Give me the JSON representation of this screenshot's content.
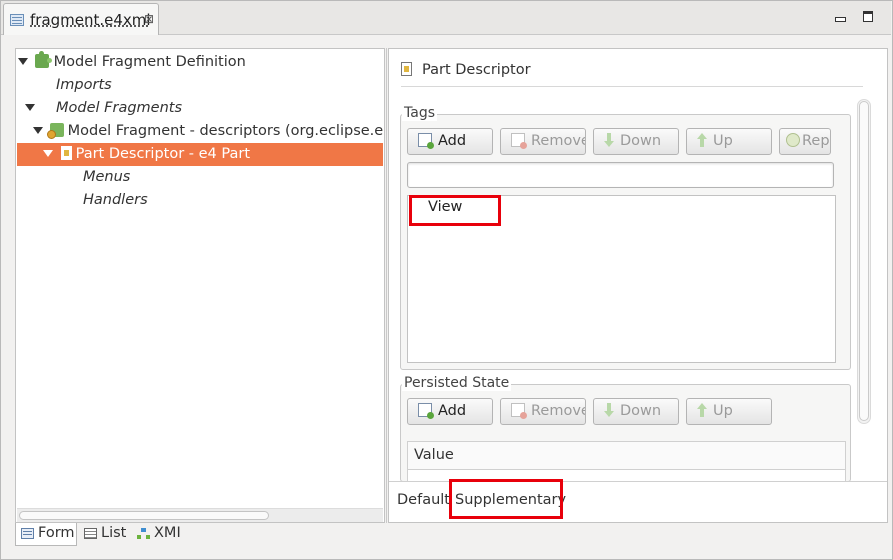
{
  "editor": {
    "tab_title": "fragment.e4xmi",
    "close_glyph": "⊠"
  },
  "tree": {
    "items": [
      {
        "label": "Model Fragment Definition"
      },
      {
        "label": "Imports"
      },
      {
        "label": "Model Fragments"
      },
      {
        "label": "Model Fragment - descriptors (org.eclipse.e4.le"
      },
      {
        "label": "Part Descriptor - e4 Part"
      },
      {
        "label": "Menus"
      },
      {
        "label": "Handlers"
      }
    ]
  },
  "detail": {
    "title": "Part Descriptor",
    "tags": {
      "group_label": "Tags",
      "buttons": {
        "add": "Add",
        "remove": "Remove",
        "down": "Down",
        "up": "Up",
        "replace": "Rep"
      },
      "input_value": "",
      "items": [
        "View"
      ]
    },
    "persisted_state": {
      "group_label": "Persisted State",
      "buttons": {
        "add": "Add",
        "remove": "Remove",
        "down": "Down",
        "up": "Up"
      },
      "column_header": "Value"
    },
    "inner_tabs": {
      "default": "Default",
      "supplementary": "Supplementary"
    }
  },
  "page_tabs": [
    {
      "label": "Form",
      "icon": "form-icon"
    },
    {
      "label": "List",
      "icon": "table-icon"
    },
    {
      "label": "XMI",
      "icon": "hierarchy-icon"
    }
  ],
  "highlight_color": "#e8000b",
  "selection_color": "#f07746"
}
